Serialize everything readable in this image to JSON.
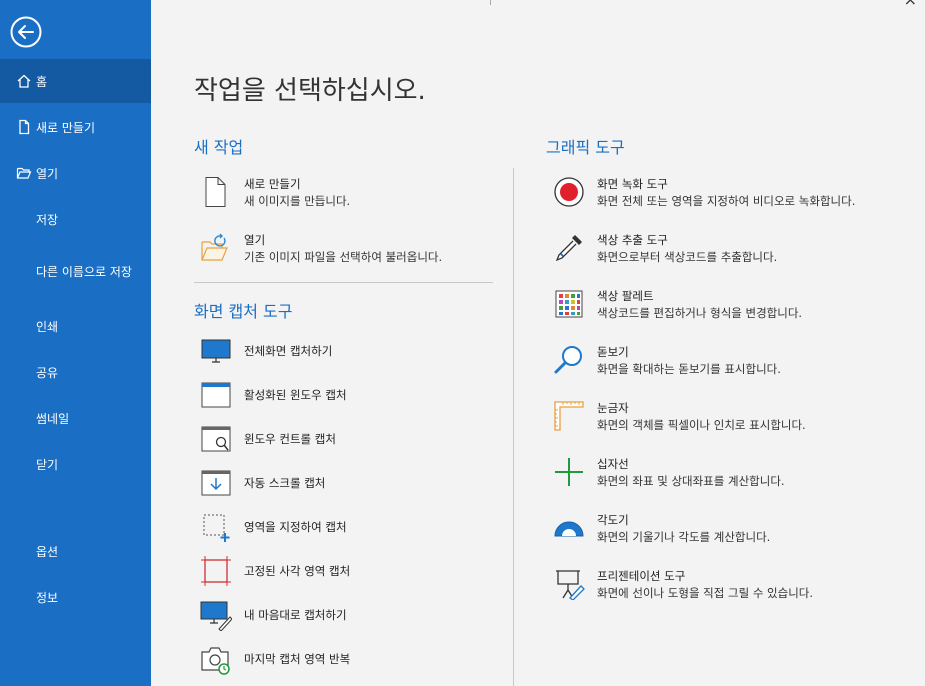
{
  "sidebar": {
    "items": [
      {
        "label": "홈"
      },
      {
        "label": "새로 만들기"
      },
      {
        "label": "열기"
      },
      {
        "label": "저장"
      },
      {
        "label": "다른 이름으로 저장"
      },
      {
        "label": "인쇄"
      },
      {
        "label": "공유"
      },
      {
        "label": "썸네일"
      },
      {
        "label": "닫기"
      },
      {
        "label": "옵션"
      },
      {
        "label": "정보"
      }
    ]
  },
  "main": {
    "title": "작업을 선택하십시오.",
    "close_glyph": "×",
    "new_task": {
      "heading": "새 작업",
      "items": [
        {
          "title": "새로 만들기",
          "desc": "새 이미지를 만듭니다."
        },
        {
          "title": "열기",
          "desc": "기존 이미지 파일을 선택하여 불러옵니다."
        }
      ]
    },
    "capture": {
      "heading": "화면 캡처 도구",
      "items": [
        {
          "label": "전체화면 캡처하기"
        },
        {
          "label": "활성화된 윈도우 캡처"
        },
        {
          "label": "윈도우 컨트롤 캡처"
        },
        {
          "label": "자동 스크롤 캡처"
        },
        {
          "label": "영역을 지정하여 캡처"
        },
        {
          "label": "고정된 사각 영역 캡처"
        },
        {
          "label": "내 마음대로 캡처하기"
        },
        {
          "label": "마지막 캡처 영역 반복"
        }
      ]
    },
    "graphics": {
      "heading": "그래픽 도구",
      "items": [
        {
          "title": "화면 녹화 도구",
          "desc": "화면 전체 또는 영역을 지정하여 비디오로 녹화합니다."
        },
        {
          "title": "색상 추출 도구",
          "desc": "화면으로부터 색상코드를 추출합니다."
        },
        {
          "title": "색상 팔레트",
          "desc": "색상코드를 편집하거나 형식을 변경합니다."
        },
        {
          "title": "돋보기",
          "desc": "화면을 확대하는 돋보기를 표시합니다."
        },
        {
          "title": "눈금자",
          "desc": "화면의 객체를 픽셀이나 인치로 표시합니다."
        },
        {
          "title": "십자선",
          "desc": "화면의 좌표 및 상대좌표를 계산합니다."
        },
        {
          "title": "각도기",
          "desc": "화면의 기울기나 각도를 계산합니다."
        },
        {
          "title": "프리젠테이션 도구",
          "desc": "화면에 선이나 도형을 직접 그릴 수 있습니다."
        }
      ]
    }
  },
  "colors": {
    "sidebar": "#1a6fc5",
    "sidebar_active": "#135aa3",
    "accent": "#1a6fc5",
    "background": "#f3f3f3"
  }
}
